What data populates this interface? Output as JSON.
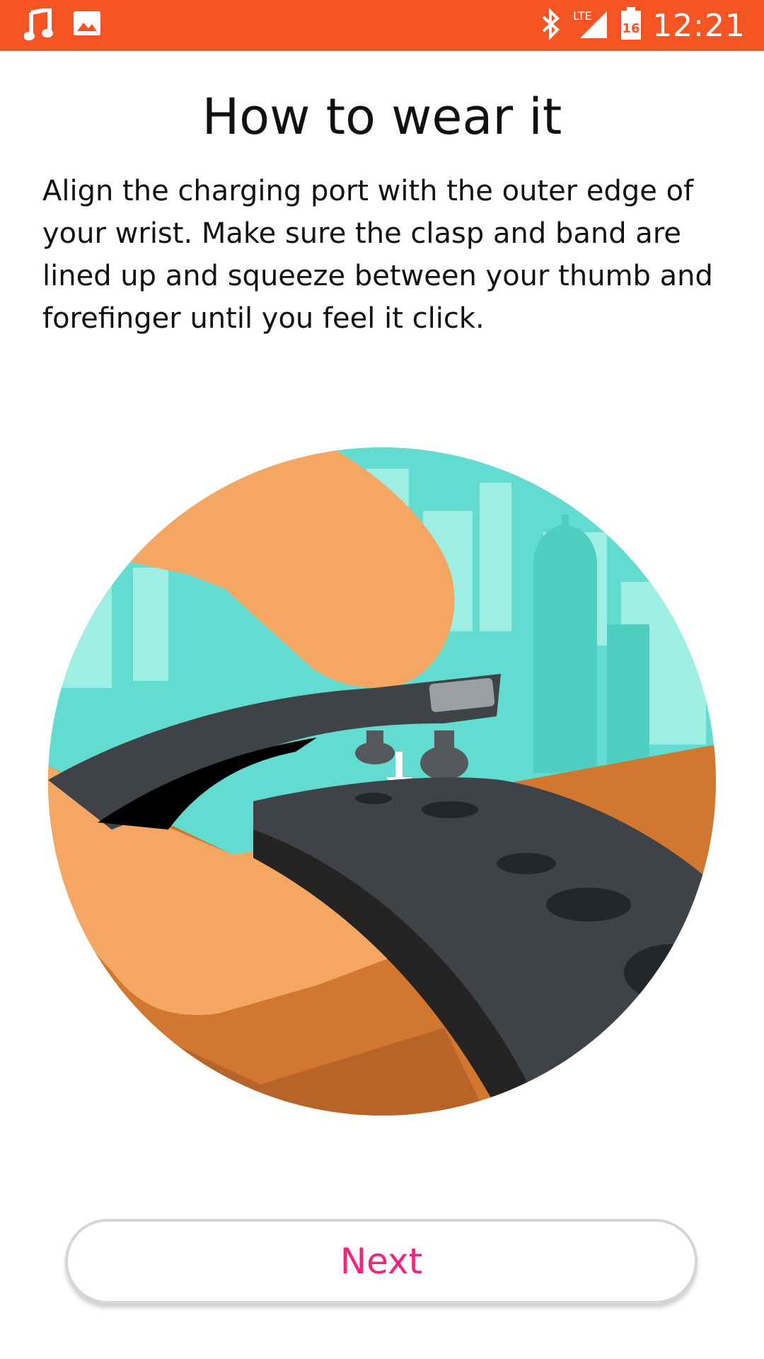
{
  "status_bar": {
    "time": "12:21",
    "battery_level": "16",
    "network": "LTE",
    "icons": [
      "music-note-icon",
      "image-icon",
      "bluetooth-icon",
      "lte-signal-icon",
      "battery-icon"
    ]
  },
  "page": {
    "title": "How to wear it",
    "description": "Align the charging port with the outer edge of your wrist. Make sure the clasp and band are lined up and squeeze between your thumb and forefinger until you feel it click."
  },
  "actions": {
    "next_label": "Next"
  },
  "colors": {
    "status_bar": "#f65423",
    "accent_text": "#f2237c",
    "sky": "#62dcd0",
    "skin": "#f4a662",
    "band": "#3f4347"
  }
}
